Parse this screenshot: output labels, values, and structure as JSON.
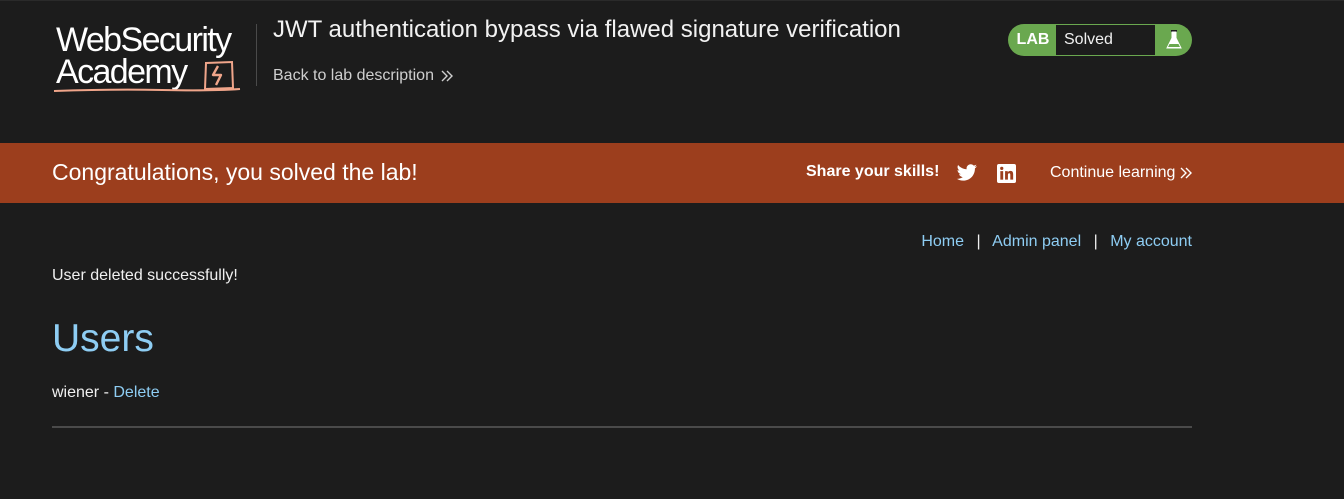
{
  "logo": {
    "line1": "WebSecurity",
    "line2": "Academy"
  },
  "header": {
    "lab_title": "JWT authentication bypass via flawed signature verification",
    "back_link": "Back to lab description"
  },
  "status": {
    "label": "LAB",
    "state": "Solved",
    "icon": "flask-icon",
    "color": "#6aa84f"
  },
  "banner": {
    "message": "Congratulations, you solved the lab!",
    "share_label": "Share your skills!",
    "share_icons": [
      "twitter-icon",
      "linkedin-icon"
    ],
    "continue_label": "Continue learning",
    "color": "#9c3e1d"
  },
  "nav": {
    "home": "Home",
    "separator": "|",
    "admin_panel": "Admin panel",
    "my_account": "My account"
  },
  "main": {
    "message": "User deleted successfully!",
    "heading": "Users",
    "users": [
      {
        "name": "wiener",
        "separator": "-",
        "action": "Delete"
      }
    ]
  },
  "colors": {
    "background": "#1c1c1c",
    "link": "#8ecdf3"
  }
}
